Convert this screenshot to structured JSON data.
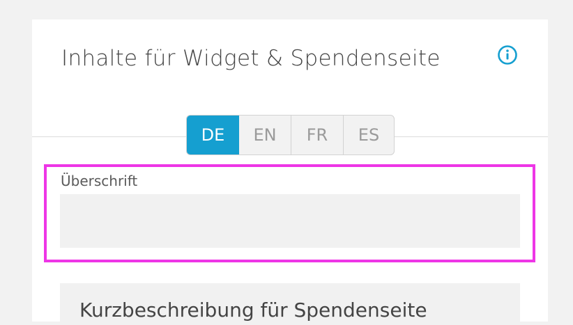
{
  "card": {
    "title": "Inhalte für Widget & Spendenseite",
    "info_icon": "info-circle-icon"
  },
  "language_tabs": {
    "items": [
      {
        "label": "DE",
        "active": true
      },
      {
        "label": "EN",
        "active": false
      },
      {
        "label": "FR",
        "active": false
      },
      {
        "label": "ES",
        "active": false
      }
    ],
    "active_color": "#159fd0"
  },
  "headline_field": {
    "label": "Überschrift",
    "value": "",
    "placeholder": ""
  },
  "short_description": {
    "title": "Kurzbeschreibung für Spendenseite"
  },
  "colors": {
    "accent": "#159fd0",
    "highlight": "#ee36e6"
  }
}
